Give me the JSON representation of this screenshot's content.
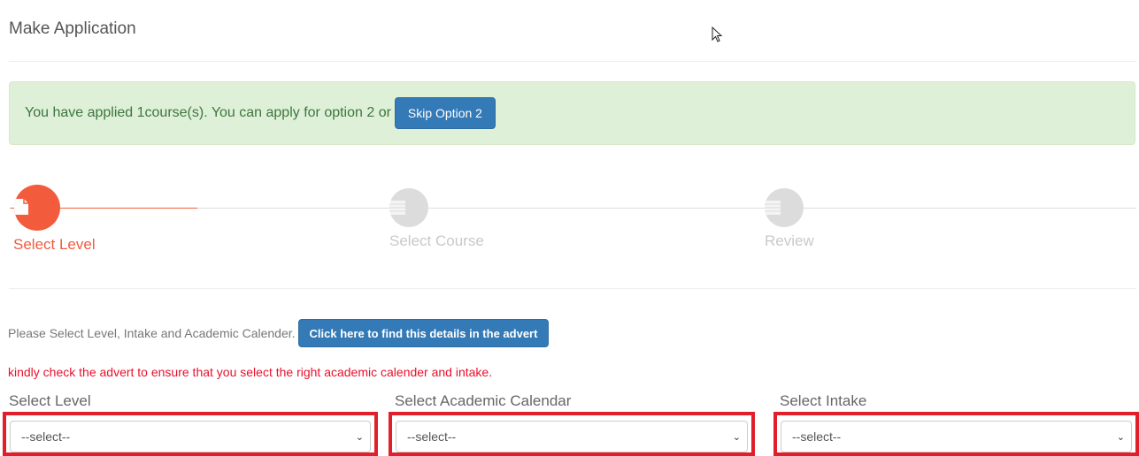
{
  "page": {
    "title": "Make Application"
  },
  "alert": {
    "text": "You have applied 1course(s). You can apply for option 2 or",
    "skip_button": "Skip Option 2",
    "bg_color": "#dff0d8",
    "text_color": "#3c763d"
  },
  "stepper": {
    "active_color": "#ef5c3f",
    "inactive_color": "#c9c9c9",
    "steps": [
      {
        "label": "Select Level",
        "icon": "document-icon",
        "state": "active"
      },
      {
        "label": "Select Course",
        "icon": "list-icon",
        "state": "inactive"
      },
      {
        "label": "Review",
        "icon": "list-icon",
        "state": "inactive"
      }
    ]
  },
  "instructions": {
    "text": "Please Select Level, Intake and Academic Calender.",
    "advert_button": "Click here to find this details in the advert",
    "warning": "kindly check the advert to ensure that you select the right academic calender and intake.",
    "warning_color": "#e8112d"
  },
  "form": {
    "highlight_color": "#e01f2a",
    "fields": [
      {
        "label": "Select Level",
        "selected": "--select--"
      },
      {
        "label": "Select Academic Calendar",
        "selected": "--select--"
      },
      {
        "label": "Select Intake",
        "selected": "--select--"
      }
    ]
  },
  "icons": {
    "chevron": "⌄",
    "cursor": "mouse-pointer-icon"
  }
}
